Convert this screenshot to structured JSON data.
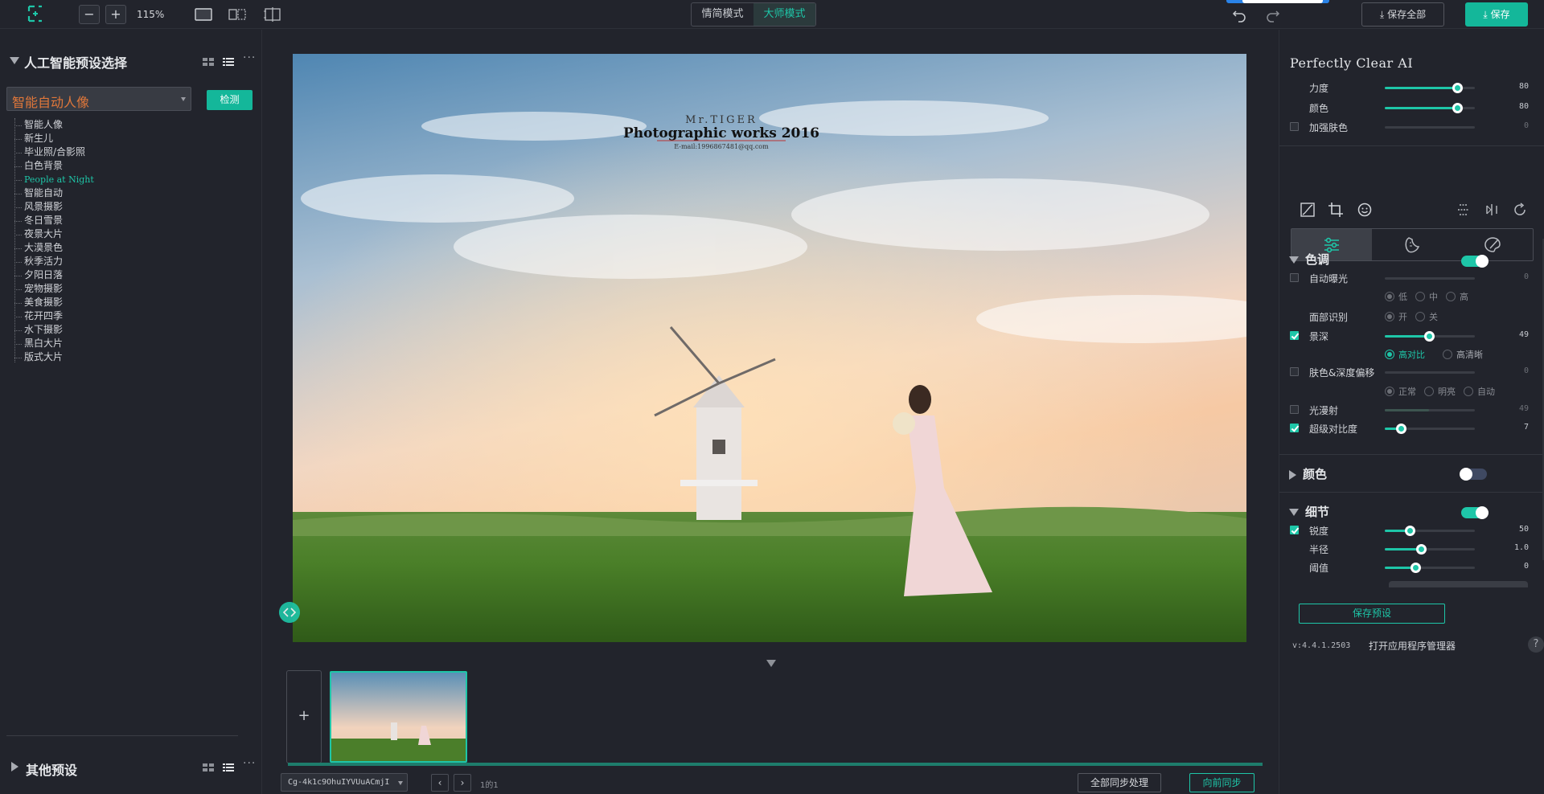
{
  "topbar": {
    "zoom": "115%",
    "modes": [
      "情简模式",
      "大师模式"
    ],
    "active_mode": 1,
    "save_all": "保存全部",
    "save": "保存",
    "zoom_out": "−",
    "zoom_in": "+"
  },
  "left": {
    "title": "人工智能预设选择",
    "selected_preset": "智能自动人像",
    "detect": "检测",
    "presets": [
      "智能人像",
      "新生儿",
      "毕业照/合影照",
      "白色背景",
      "People at Night",
      "智能自动",
      "风景摄影",
      "冬日雪景",
      "夜景大片",
      "大漠景色",
      "秋季活力",
      "夕阳日落",
      "宠物摄影",
      "美食摄影",
      "花开四季",
      "水下摄影",
      "黑白大片",
      "版式大片"
    ],
    "highlighted_index": 4,
    "other_title": "其他预设",
    "more": "···"
  },
  "canvas": {
    "watermark_top": "Mr.TIGER",
    "watermark_title": "Photographic works 2016",
    "watermark_email": "E-mail:1996867481@qq.com",
    "add": "+",
    "filename": "Cg-4k1c9OhuIYVUuACmjI",
    "prev": "‹",
    "next": "›",
    "page_info": "1的1",
    "sync_all": "全部同步处理",
    "sync_forward": "向前同步"
  },
  "right": {
    "title": "Perfectly Clear AI",
    "top_sliders": [
      {
        "label": "力度",
        "value": 80,
        "checkbox": false,
        "enabled": true
      },
      {
        "label": "颜色",
        "value": 80,
        "checkbox": false,
        "enabled": true
      },
      {
        "label": "加强肤色",
        "value": 0,
        "checkbox": true,
        "checked": false,
        "enabled": false
      }
    ],
    "section_tone": "色调",
    "tone_on": true,
    "auto_exposure": {
      "label": "自动曝光",
      "value": 0
    },
    "exposure_levels": [
      "低",
      "中",
      "高"
    ],
    "face_detect": {
      "label": "面部识别",
      "options": [
        "开",
        "关"
      ]
    },
    "depth": {
      "label": "景深",
      "value": 49
    },
    "depth_modes": [
      "高对比",
      "高清晰"
    ],
    "skin_depth": {
      "label": "肤色&深度偏移",
      "value": 0
    },
    "skin_modes": [
      "正常",
      "明亮",
      "自动"
    ],
    "light_diffuse": {
      "label": "光漫射",
      "value": 49
    },
    "super_contrast": {
      "label": "超级对比度",
      "value": 7
    },
    "section_color": "颜色",
    "color_on": false,
    "section_detail": "细节",
    "detail_on": true,
    "sharpness": {
      "label": "锐度",
      "value": 50
    },
    "radius": {
      "label": "半径",
      "value": "1.0"
    },
    "threshold": {
      "label": "阈值",
      "value": 0
    },
    "save_preset": "保存预设",
    "version": "v:4.4.1.2503",
    "open_manager": "打开应用程序管理器",
    "help": "?"
  },
  "colors": {
    "accent": "#1ec6a8",
    "bg": "#22242c",
    "preset_orange": "#e0773a"
  }
}
